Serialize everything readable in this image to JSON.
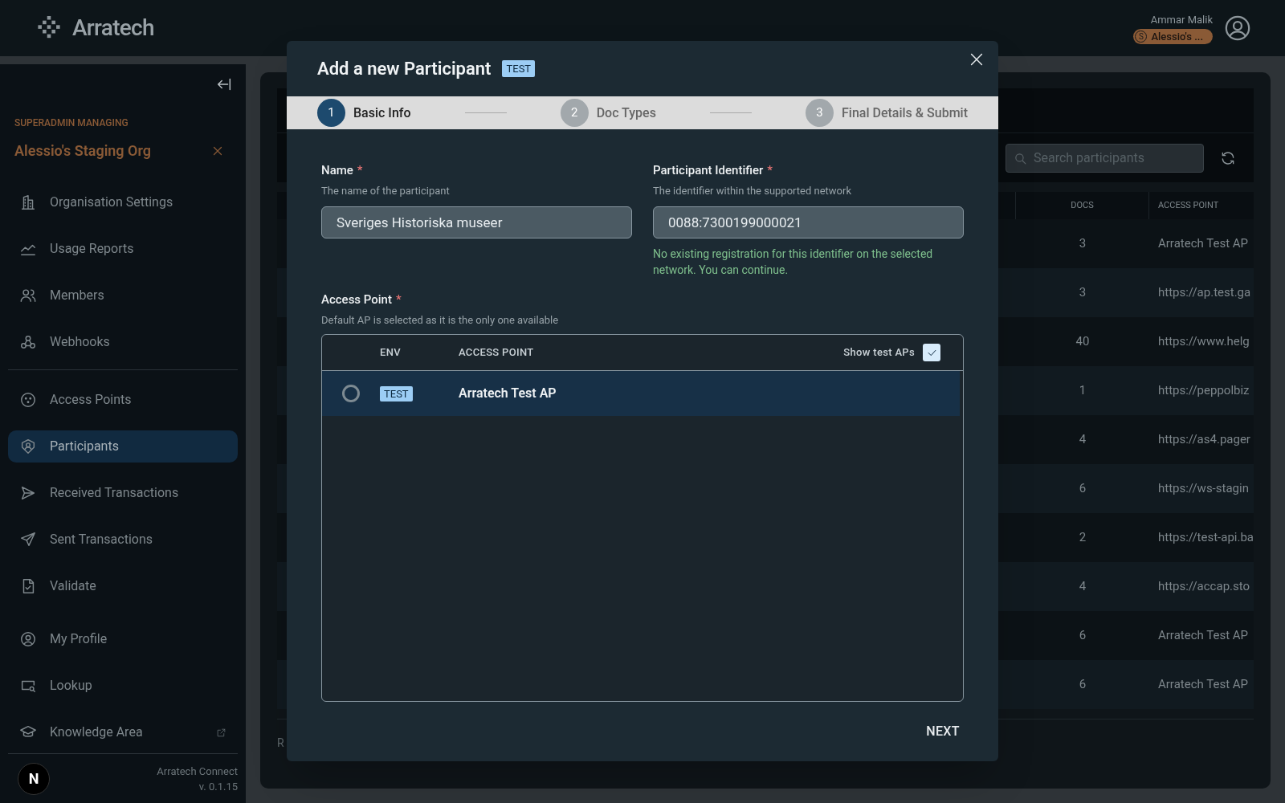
{
  "header": {
    "logo_text": "Arratech",
    "user_name": "Ammar Malik",
    "org_badge": {
      "letter": "S",
      "label": "Alessio's ..."
    }
  },
  "sidebar": {
    "section_label": "SUPERADMIN MANAGING",
    "org_name": "Alessio's Staging Org",
    "sections": [
      {
        "divider": false,
        "items": [
          {
            "label": "Organisation Settings",
            "selected": false
          },
          {
            "label": "Usage Reports",
            "selected": false
          },
          {
            "label": "Members",
            "selected": false
          },
          {
            "label": "Webhooks",
            "selected": false
          }
        ]
      },
      {
        "divider": true,
        "items": [
          {
            "label": "Access Points",
            "selected": false
          },
          {
            "label": "Participants",
            "selected": true
          },
          {
            "label": "Received Transactions",
            "selected": false
          },
          {
            "label": "Sent Transactions",
            "selected": false
          },
          {
            "label": "Validate",
            "selected": false
          }
        ]
      },
      {
        "divider": false,
        "items": [
          {
            "label": "My Profile",
            "selected": false
          },
          {
            "label": "Lookup",
            "selected": false
          },
          {
            "label": "Knowledge Area",
            "selected": false,
            "external": true
          }
        ]
      }
    ],
    "footer": {
      "avatar_letter": "N",
      "app_name": "Arratech Connect",
      "version": "v. 0.1.15"
    }
  },
  "participants_panel": {
    "search": {
      "placeholder": "Search participants"
    },
    "columns": [
      "DOCS",
      "ACCESS POINT"
    ],
    "rows": [
      {
        "docs": "3",
        "access_point": "Arratech Test AP"
      },
      {
        "docs": "3",
        "access_point": "https://ap.test.ga"
      },
      {
        "docs": "40",
        "access_point": "https://www.helg"
      },
      {
        "docs": "1",
        "access_point": "https://peppolbiz"
      },
      {
        "docs": "4",
        "access_point": "https://as4.pager"
      },
      {
        "docs": "6",
        "access_point": "https://ws-stagin"
      },
      {
        "docs": "2",
        "access_point": "https://test-api.ba"
      },
      {
        "docs": "4",
        "access_point": "https://accap.sto"
      },
      {
        "docs": "6",
        "access_point": "Arratech Test AP"
      },
      {
        "docs": "6",
        "access_point": "Arratech Test AP"
      }
    ],
    "footer_text": "R"
  },
  "modal": {
    "title": "Add a new Participant",
    "badge": "TEST",
    "steps": [
      {
        "number": "1",
        "label": "Basic Info",
        "selected": true
      },
      {
        "number": "2",
        "label": "Doc Types",
        "selected": false
      },
      {
        "number": "3",
        "label": "Final Details & Submit",
        "selected": false
      }
    ],
    "fields": [
      {
        "label": "Name",
        "required_mark": "*",
        "hint": "The name of the participant",
        "value": "Sveriges Historiska museer"
      },
      {
        "label": "Participant Identifier",
        "required_mark": "*",
        "hint": "The identifier within the supported network",
        "value": "0088:7300199000021",
        "message": "No existing registration for this identifier on the selected network. You can continue."
      }
    ],
    "access_point": {
      "label": "Access Point",
      "required_mark": "*",
      "hint": "Default AP is selected as it is the only one available",
      "columns": [
        "ENV",
        "ACCESS POINT"
      ],
      "show_test": {
        "label": "Show test APs",
        "checked": true
      },
      "rows": [
        {
          "env": "TEST",
          "name": "Arratech Test AP",
          "selected": false,
          "highlighted": true
        }
      ]
    },
    "next_button": "NEXT"
  }
}
